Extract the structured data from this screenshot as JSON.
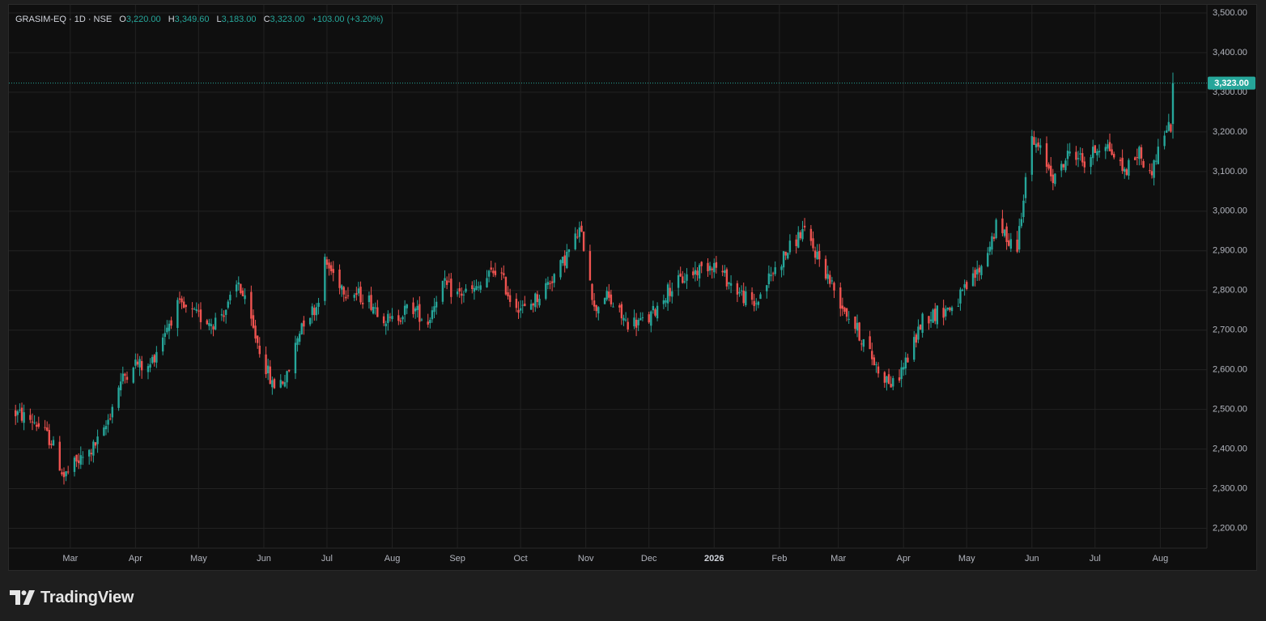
{
  "legend": {
    "symbol": "GRASIM-EQ · 1D · NSE",
    "open_label": "O",
    "open_value": "3,220.00",
    "high_label": "H",
    "high_value": "3,349.60",
    "low_label": "L",
    "low_value": "3,183.00",
    "close_label": "C",
    "close_value": "3,323.00",
    "change": "+103.00 (+3.20%)"
  },
  "last_price_badge": "3,323.00",
  "footer": {
    "brand": "TradingView",
    "logo_icon": "tradingview-logo-icon"
  },
  "colors": {
    "up": "#26a69a",
    "down": "#ef5350",
    "background": "#0f0f0f",
    "grid": "#222222",
    "axis_text": "#b2b5be"
  },
  "chart_data": {
    "type": "candlestick",
    "title": "",
    "xlabel": "",
    "ylabel": "",
    "ylim": [
      2150,
      3500
    ],
    "y_ticks": [
      "2,200.00",
      "2,300.00",
      "2,400.00",
      "2,500.00",
      "2,600.00",
      "2,700.00",
      "2,800.00",
      "2,900.00",
      "3,000.00",
      "3,100.00",
      "3,200.00",
      "3,300.00",
      "3,400.00",
      "3,500.00"
    ],
    "y_tick_values": [
      2200,
      2300,
      2400,
      2500,
      2600,
      2700,
      2800,
      2900,
      3000,
      3100,
      3200,
      3300,
      3400,
      3500
    ],
    "x_range": [
      "2025-02-01",
      "2026-08-12"
    ],
    "x_ticks": [
      {
        "label": "Mar",
        "date": "2025-03-01"
      },
      {
        "label": "Apr",
        "date": "2025-04-01"
      },
      {
        "label": "May",
        "date": "2025-05-01"
      },
      {
        "label": "Jun",
        "date": "2025-06-01"
      },
      {
        "label": "Jul",
        "date": "2025-07-01"
      },
      {
        "label": "Aug",
        "date": "2025-08-01"
      },
      {
        "label": "Sep",
        "date": "2025-09-01"
      },
      {
        "label": "Oct",
        "date": "2025-10-01"
      },
      {
        "label": "Nov",
        "date": "2025-11-01"
      },
      {
        "label": "Dec",
        "date": "2025-12-01"
      },
      {
        "label": "2026",
        "date": "2026-01-01",
        "bold": true
      },
      {
        "label": "Feb",
        "date": "2026-02-01"
      },
      {
        "label": "Mar",
        "date": "2026-03-01"
      },
      {
        "label": "Apr",
        "date": "2026-04-01"
      },
      {
        "label": "May",
        "date": "2026-05-01"
      },
      {
        "label": "Jun",
        "date": "2026-06-01"
      },
      {
        "label": "Jul",
        "date": "2026-07-01"
      },
      {
        "label": "Aug",
        "date": "2026-08-01"
      }
    ],
    "last_close": 3323,
    "price_path": [
      [
        "2025-02-01",
        2495
      ],
      [
        "2025-02-12",
        2470
      ],
      [
        "2025-02-20",
        2420
      ],
      [
        "2025-02-26",
        2330
      ],
      [
        "2025-03-03",
        2360
      ],
      [
        "2025-03-10",
        2390
      ],
      [
        "2025-03-17",
        2440
      ],
      [
        "2025-03-24",
        2560
      ],
      [
        "2025-03-31",
        2620
      ],
      [
        "2025-04-07",
        2600
      ],
      [
        "2025-04-15",
        2700
      ],
      [
        "2025-04-21",
        2760
      ],
      [
        "2025-04-28",
        2740
      ],
      [
        "2025-05-08",
        2720
      ],
      [
        "2025-05-15",
        2760
      ],
      [
        "2025-05-20",
        2820
      ],
      [
        "2025-05-27",
        2700
      ],
      [
        "2025-06-05",
        2560
      ],
      [
        "2025-06-12",
        2580
      ],
      [
        "2025-06-19",
        2720
      ],
      [
        "2025-06-26",
        2760
      ],
      [
        "2025-06-30",
        2870
      ],
      [
        "2025-07-10",
        2800
      ],
      [
        "2025-07-20",
        2780
      ],
      [
        "2025-07-31",
        2720
      ],
      [
        "2025-08-10",
        2760
      ],
      [
        "2025-08-18",
        2720
      ],
      [
        "2025-08-24",
        2820
      ],
      [
        "2025-08-31",
        2790
      ],
      [
        "2025-09-10",
        2800
      ],
      [
        "2025-09-20",
        2860
      ],
      [
        "2025-09-26",
        2780
      ],
      [
        "2025-10-03",
        2750
      ],
      [
        "2025-10-10",
        2790
      ],
      [
        "2025-10-20",
        2860
      ],
      [
        "2025-10-29",
        2950
      ],
      [
        "2025-11-02",
        2880
      ],
      [
        "2025-11-05",
        2750
      ],
      [
        "2025-11-10",
        2790
      ],
      [
        "2025-11-20",
        2720
      ],
      [
        "2025-11-30",
        2720
      ],
      [
        "2025-12-10",
        2800
      ],
      [
        "2025-12-20",
        2840
      ],
      [
        "2025-12-31",
        2870
      ],
      [
        "2026-01-10",
        2810
      ],
      [
        "2026-01-20",
        2760
      ],
      [
        "2026-01-27",
        2830
      ],
      [
        "2026-02-05",
        2900
      ],
      [
        "2026-02-12",
        2950
      ],
      [
        "2026-02-20",
        2880
      ],
      [
        "2026-03-01",
        2780
      ],
      [
        "2026-03-10",
        2700
      ],
      [
        "2026-03-20",
        2600
      ],
      [
        "2026-03-27",
        2560
      ],
      [
        "2026-04-05",
        2650
      ],
      [
        "2026-04-10",
        2730
      ],
      [
        "2026-04-25",
        2760
      ],
      [
        "2026-05-08",
        2860
      ],
      [
        "2026-05-15",
        2960
      ],
      [
        "2026-05-25",
        2910
      ],
      [
        "2026-05-31",
        3180
      ],
      [
        "2026-06-05",
        3150
      ],
      [
        "2026-06-12",
        3080
      ],
      [
        "2026-06-20",
        3160
      ],
      [
        "2026-06-26",
        3120
      ],
      [
        "2026-07-05",
        3180
      ],
      [
        "2026-07-15",
        3100
      ],
      [
        "2026-07-22",
        3150
      ],
      [
        "2026-07-27",
        3090
      ],
      [
        "2026-08-03",
        3200
      ],
      [
        "2026-08-07",
        3220
      ],
      [
        "2026-08-08",
        3323
      ]
    ]
  }
}
